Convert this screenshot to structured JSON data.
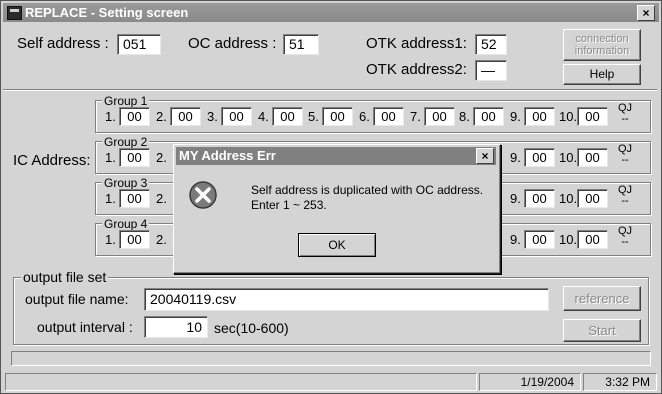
{
  "window": {
    "title": "REPLACE - Setting screen",
    "close": "×"
  },
  "header": {
    "self_address_label": "Self address :",
    "self_address_value": "051",
    "oc_address_label": "OC address :",
    "oc_address_value": "51",
    "otk1_label": "OTK address1:",
    "otk1_value": "52",
    "otk2_label": "OTK address2:",
    "otk2_value": "—",
    "connection_info_button": [
      "connection",
      "information"
    ],
    "help_button": "Help"
  },
  "ic_address_label": "IC Address:",
  "groups": [
    {
      "label": "Group 1"
    },
    {
      "label": "Group 2"
    },
    {
      "label": "Group 3"
    },
    {
      "label": "Group 4"
    }
  ],
  "slot_numbers": [
    "1.",
    "2.",
    "3.",
    "4.",
    "5.",
    "6.",
    "7.",
    "8.",
    "9.",
    "10."
  ],
  "group1_values": [
    "00",
    "00",
    "00",
    "00",
    "00",
    "00",
    "00",
    "00",
    "00",
    "00"
  ],
  "partial_values": {
    "slot1": "00",
    "slot2_label": "2.",
    "slot9": "00",
    "slot10": "00"
  },
  "qj": {
    "top": "QJ",
    "bottom": "--"
  },
  "dialog": {
    "title": "MY Address Err",
    "close": "×",
    "message_line1": "Self address is duplicated with OC address.",
    "message_line2": "Enter 1 ~ 253.",
    "ok": "OK"
  },
  "output": {
    "group_label": "output file set",
    "file_name_label": "output file name:",
    "file_name_value": "20040119.csv",
    "interval_label": "output interval :",
    "interval_value": "10",
    "interval_unit": "sec(10-600)",
    "reference_button": "reference",
    "start_button": "Start"
  },
  "statusbar": {
    "date": "1/19/2004",
    "time": "3:32 PM"
  }
}
